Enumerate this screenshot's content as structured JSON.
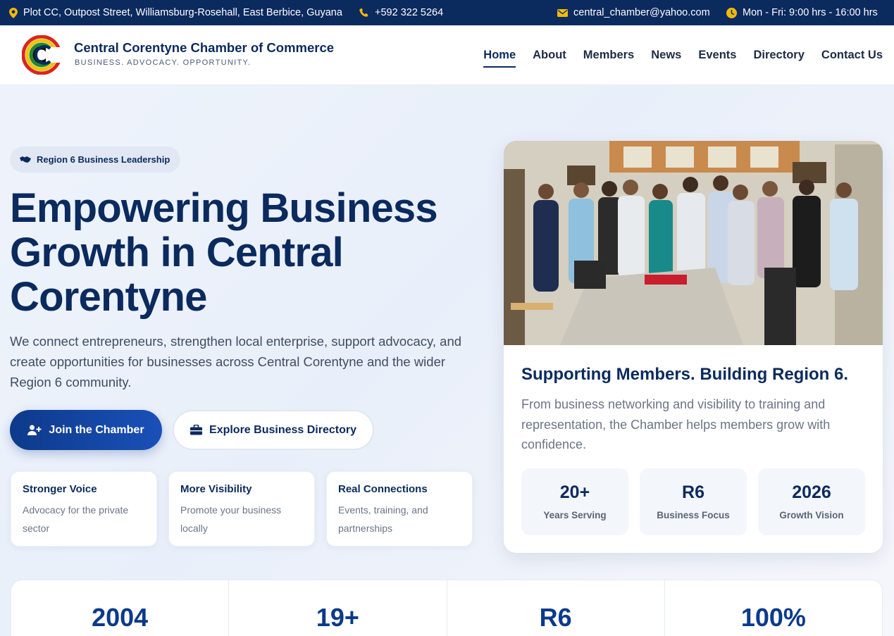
{
  "topbar": {
    "address": "Plot CC, Outpost Street, Williamsburg-Rosehall, East Berbice, Guyana",
    "phone": "+592 322 5264",
    "email": "central_chamber@yahoo.com",
    "hours": "Mon - Fri: 9:00 hrs - 16:00 hrs"
  },
  "header": {
    "brand_name": "Central Corentyne Chamber of Commerce",
    "tagline": "BUSINESS. ADVOCACY. OPPORTUNITY."
  },
  "nav": {
    "items": [
      "Home",
      "About",
      "Members",
      "News",
      "Events",
      "Directory",
      "Contact Us"
    ],
    "active": "Home"
  },
  "hero": {
    "pill": "Region 6 Business Leadership",
    "title": "Empowering Business Growth in Central Corentyne",
    "description": "We connect entrepreneurs, strengthen local enterprise, support advocacy, and create opportunities for businesses across Central Corentyne and the wider Region 6 community.",
    "primary_button": "Join the Chamber",
    "secondary_button": "Explore Business Directory",
    "highlights": [
      {
        "title": "Stronger Voice",
        "desc": "Advocacy for the private sector"
      },
      {
        "title": "More Visibility",
        "desc": "Promote your business locally"
      },
      {
        "title": "Real Connections",
        "desc": "Events, training, and partnerships"
      }
    ]
  },
  "feature_card": {
    "title": "Supporting Members. Building Region 6.",
    "description": "From business networking and visibility to training and representation, the Chamber helps members grow with confidence.",
    "stats": [
      {
        "value": "20+",
        "label": "Years Serving"
      },
      {
        "value": "R6",
        "label": "Business Focus"
      },
      {
        "value": "2026",
        "label": "Growth Vision"
      }
    ]
  },
  "stats_bar": [
    "2004",
    "19+",
    "R6",
    "100%"
  ],
  "colors": {
    "navy": "#0b2a5e",
    "accent_yellow": "#f2b90d",
    "primary_blue": "#1a50b8"
  }
}
